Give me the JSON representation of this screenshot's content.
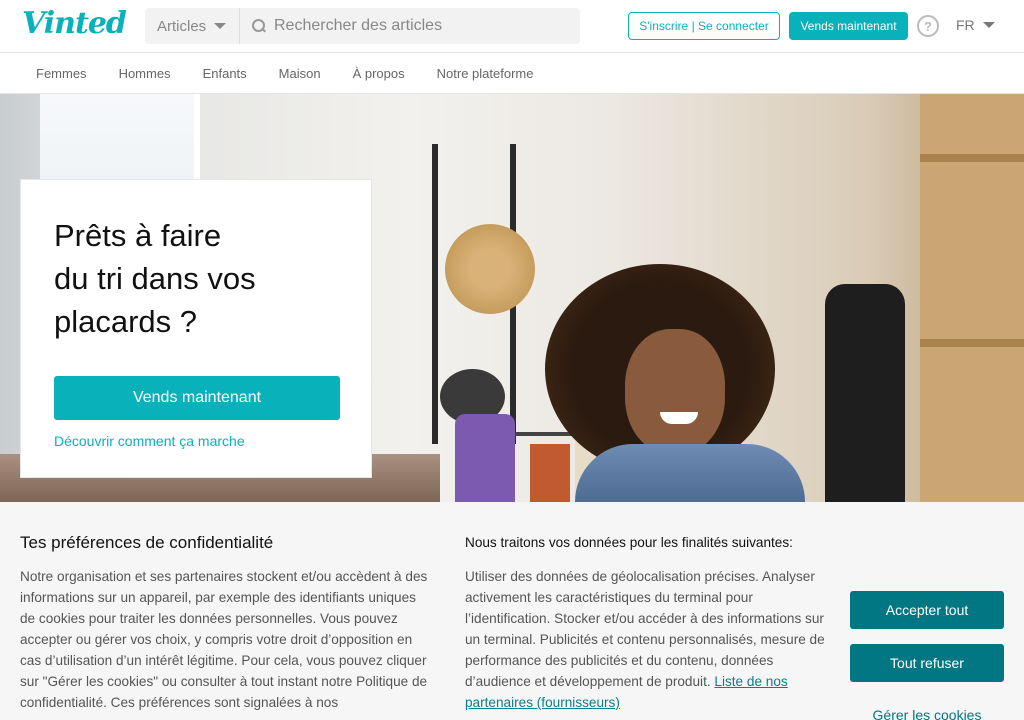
{
  "header": {
    "logo": "Vinted",
    "search_category": "Articles",
    "search_placeholder": "Rechercher des articles",
    "login_label": "S'inscrire | Se connecter",
    "sell_label": "Vends maintenant",
    "help_glyph": "?",
    "language": "FR"
  },
  "nav": {
    "items": [
      {
        "label": "Femmes"
      },
      {
        "label": "Hommes"
      },
      {
        "label": "Enfants"
      },
      {
        "label": "Maison"
      },
      {
        "label": "À propos"
      },
      {
        "label": "Notre plateforme"
      }
    ]
  },
  "hero": {
    "title_line1": "Prêts à faire",
    "title_line2": "du tri dans vos",
    "title_line3": "placards ?",
    "sell_button": "Vends maintenant",
    "how_it_works_link": "Découvrir comment ça marche"
  },
  "cookie": {
    "title": "Tes préférences de confidentialité",
    "text": "Notre organisation et ses partenaires stockent et/ou accèdent à des informations sur un appareil, par exemple des identifiants uniques de cookies pour traiter les données personnelles. Vous pouvez accepter ou gérer vos choix, y compris votre droit d’opposition en cas d’utilisation d’un intérêt légitime. Pour cela, vous pouvez cliquer sur \"Gérer les cookies\" ou consulter à tout instant notre Politique de confidentialité. Ces préférences sont signalées à nos",
    "purpose_title": "Nous traitons vos données pour les finalités suivantes:",
    "purpose_text": "Utiliser des données de géolocalisation précises. Analyser activement les caractéristiques du terminal pour l’identification. Stocker et/ou accéder à des informations sur un terminal. Publicités et contenu personnalisés, mesure de performance des publicités et du contenu, données d’audience et développement de produit.",
    "partners_link": "Liste de nos partenaires (fournisseurs)",
    "accept_label": "Accepter tout",
    "refuse_label": "Tout refuser",
    "manage_label": "Gérer les cookies"
  },
  "colors": {
    "brand": "#09b1ba",
    "cookie_button": "#007782"
  }
}
